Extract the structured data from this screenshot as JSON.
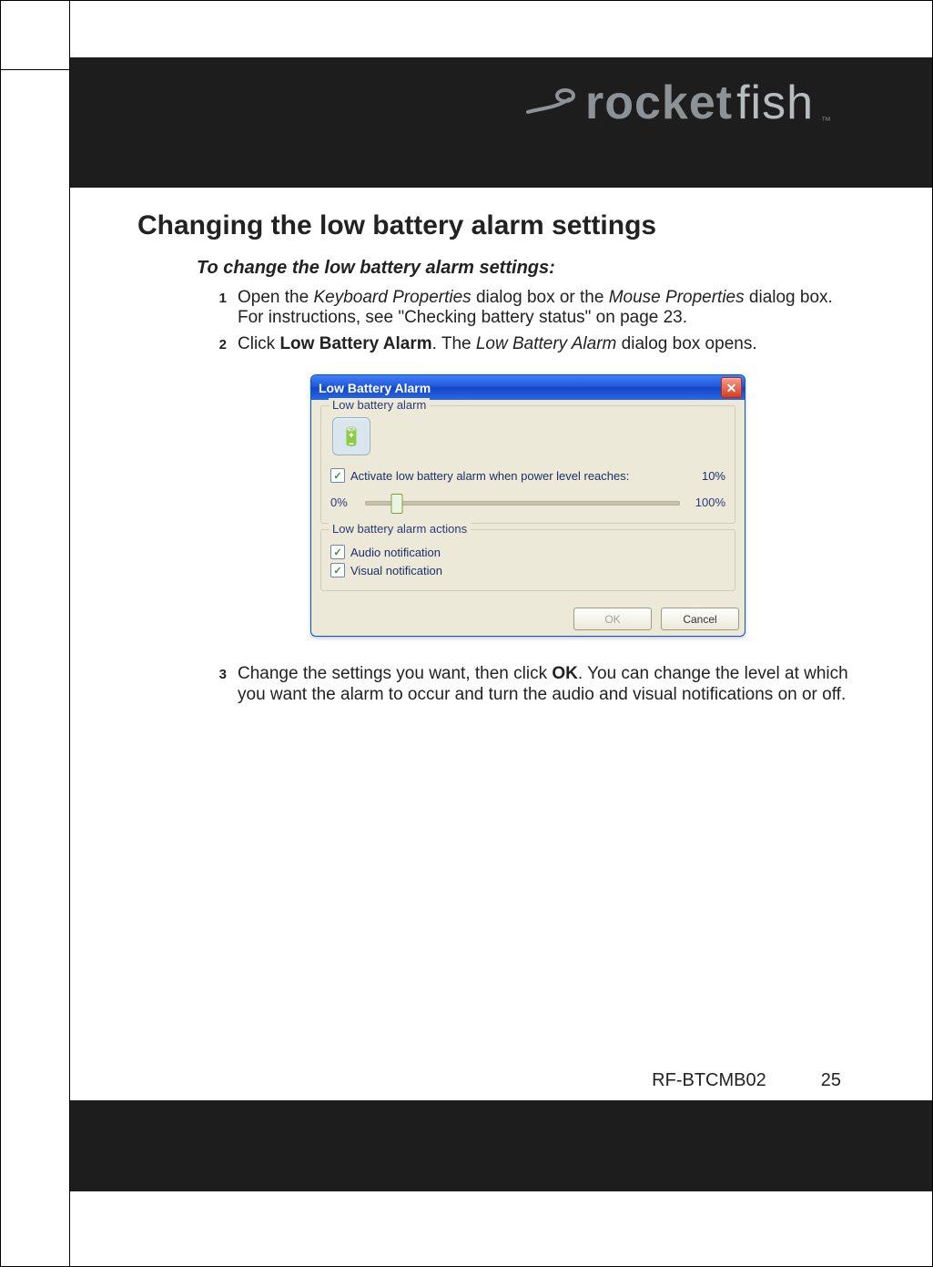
{
  "brand": {
    "name": "rocketfish",
    "tm": "™"
  },
  "section_title": "Changing the low battery alarm settings",
  "sub_title": "To change the low battery alarm settings:",
  "steps": [
    {
      "num": "1",
      "pre": "Open the ",
      "italic1": "Keyboard Properties",
      "mid1": " dialog box or the ",
      "italic2": "Mouse Properties",
      "mid2": " dialog box. For instructions, see \"Checking battery status\" on page 23."
    },
    {
      "num": "2",
      "pre": "Click ",
      "bold": "Low Battery Alarm",
      "mid1": ". The ",
      "italic1": "Low Battery Alarm",
      "post": " dialog box opens."
    },
    {
      "num": "3",
      "pre": "Change the settings you want, then click ",
      "bold": "OK",
      "post": ". You can change the level at which you want the alarm to occur and turn the audio and visual notifications on or off."
    }
  ],
  "dialog": {
    "title": "Low Battery Alarm",
    "group1_legend": "Low battery alarm",
    "checkbox1_label": "Activate low battery alarm when power level reaches:",
    "threshold_value": "10%",
    "slider_min_label": "0%",
    "slider_max_label": "100%",
    "group2_legend": "Low battery alarm actions",
    "audio_label": "Audio notification",
    "visual_label": "Visual notification",
    "ok_label": "OK",
    "cancel_label": "Cancel"
  },
  "footer": {
    "model": "RF-BTCMB02",
    "page": "25"
  }
}
